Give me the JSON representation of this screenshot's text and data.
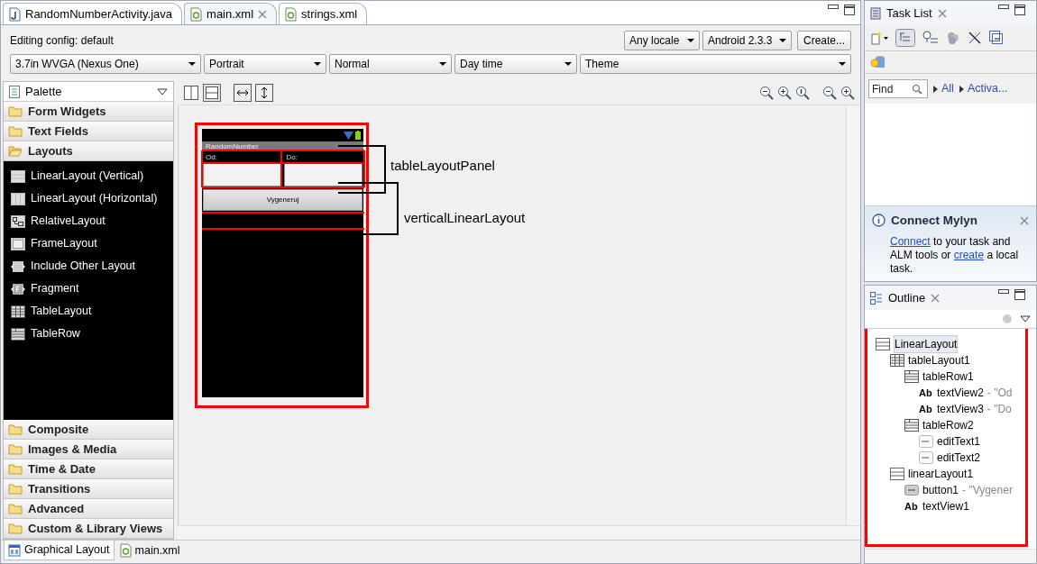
{
  "editor_tabs": [
    {
      "label": "RandomNumberActivity.java",
      "kind": "java",
      "selected": false,
      "closable": false
    },
    {
      "label": "main.xml",
      "kind": "xml",
      "selected": true,
      "closable": true
    },
    {
      "label": "strings.xml",
      "kind": "xml",
      "selected": false,
      "closable": false
    }
  ],
  "config": {
    "label": "Editing config:  default",
    "top_selects": [
      "Any locale",
      "Android 2.3.3"
    ],
    "create_button": "Create...",
    "selects": [
      "3.7in WVGA (Nexus One)",
      "Portrait",
      "Normal",
      "Day time",
      "Theme"
    ]
  },
  "palette": {
    "title": "Palette",
    "categories": [
      {
        "label": "Form Widgets",
        "expanded": false
      },
      {
        "label": "Text Fields",
        "expanded": false
      },
      {
        "label": "Layouts",
        "expanded": true,
        "items": [
          {
            "label": "LinearLayout (Vertical)",
            "kind": "vertical"
          },
          {
            "label": "LinearLayout (Horizontal)",
            "kind": "horizontal"
          },
          {
            "label": "RelativeLayout",
            "kind": "relative"
          },
          {
            "label": "FrameLayout",
            "kind": "frame"
          },
          {
            "label": "Include Other Layout",
            "kind": "include"
          },
          {
            "label": "Fragment",
            "kind": "fragment"
          },
          {
            "label": "TableLayout",
            "kind": "table"
          },
          {
            "label": "TableRow",
            "kind": "row"
          }
        ]
      },
      {
        "label": "Composite",
        "expanded": false
      },
      {
        "label": "Images & Media",
        "expanded": false
      },
      {
        "label": "Time & Date",
        "expanded": false
      },
      {
        "label": "Transitions",
        "expanded": false
      },
      {
        "label": "Advanced",
        "expanded": false
      },
      {
        "label": "Custom & Library Views",
        "expanded": false
      }
    ]
  },
  "device": {
    "app_title": "RandomNumber",
    "labels": [
      "Od:",
      "Do:"
    ],
    "button": "Vygeneruj"
  },
  "annotations": [
    "tableLayoutPanel",
    "verticalLinearLayout"
  ],
  "bottom_tabs": [
    {
      "label": "Graphical Layout",
      "kind": "graphical",
      "selected": true
    },
    {
      "label": "main.xml",
      "kind": "xml",
      "selected": false
    }
  ],
  "task_list": {
    "title": "Task List",
    "find": {
      "placeholder": "Find"
    },
    "filters": [
      "All",
      "Activa..."
    ],
    "mylyn": {
      "title": "Connect Mylyn",
      "message": [
        {
          "text": "Connect",
          "link": true
        },
        {
          "text": " to your task and ALM tools or ",
          "link": false
        },
        {
          "text": "create",
          "link": true
        },
        {
          "text": " a local task.",
          "link": false
        }
      ]
    }
  },
  "outline": {
    "title": "Outline",
    "tree": [
      {
        "label": "LinearLayout",
        "kind": "linear",
        "selected": true,
        "children": [
          {
            "label": "tableLayout1",
            "kind": "table",
            "selected": false,
            "children": [
              {
                "label": "tableRow1",
                "kind": "row",
                "selected": false,
                "children": [
                  {
                    "label": "textView2",
                    "detail": " - \"Od",
                    "kind": "text",
                    "badge": "Ab",
                    "selected": false
                  },
                  {
                    "label": "textView3",
                    "detail": " - \"Do",
                    "kind": "text",
                    "badge": "Ab",
                    "selected": false
                  }
                ]
              },
              {
                "label": "tableRow2",
                "kind": "row",
                "selected": false,
                "children": [
                  {
                    "label": "editText1",
                    "kind": "edit",
                    "selected": false
                  },
                  {
                    "label": "editText2",
                    "kind": "edit",
                    "selected": false
                  }
                ]
              }
            ]
          },
          {
            "label": "linearLayout1",
            "kind": "linear",
            "selected": false,
            "children": [
              {
                "label": "button1",
                "detail": " - \"Vygener",
                "kind": "button",
                "selected": false
              },
              {
                "label": "textView1",
                "kind": "text",
                "badge": "Ab",
                "selected": false
              }
            ]
          }
        ]
      }
    ]
  }
}
